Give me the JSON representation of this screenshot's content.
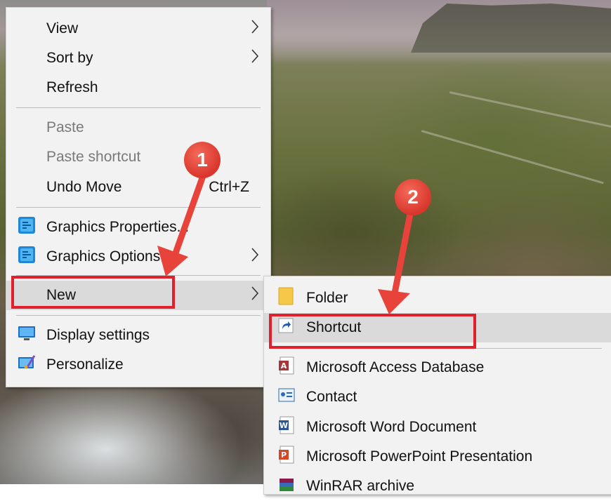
{
  "main_menu": {
    "items": [
      {
        "label": "View",
        "submenu": true
      },
      {
        "label": "Sort by",
        "submenu": true
      },
      {
        "label": "Refresh"
      },
      {
        "label": "Paste",
        "disabled": true
      },
      {
        "label": "Paste shortcut",
        "disabled": true
      },
      {
        "label": "Undo Move",
        "shortcut": "Ctrl+Z"
      },
      {
        "label": "Graphics Properties...",
        "icon": "intel-graphics-icon"
      },
      {
        "label": "Graphics Options",
        "icon": "intel-graphics-icon",
        "submenu": true
      },
      {
        "label": "New",
        "submenu": true,
        "highlighted": true
      },
      {
        "label": "Display settings",
        "icon": "display-icon"
      },
      {
        "label": "Personalize",
        "icon": "personalize-icon"
      }
    ]
  },
  "sub_menu": {
    "items": [
      {
        "label": "Folder",
        "icon": "folder-icon"
      },
      {
        "label": "Shortcut",
        "icon": "shortcut-icon",
        "highlighted": true
      },
      {
        "label": "Microsoft Access Database",
        "icon": "access-icon"
      },
      {
        "label": "Contact",
        "icon": "contact-icon"
      },
      {
        "label": "Microsoft Word Document",
        "icon": "word-icon"
      },
      {
        "label": "Microsoft PowerPoint Presentation",
        "icon": "powerpoint-icon"
      },
      {
        "label": "WinRAR archive",
        "icon": "winrar-icon"
      }
    ]
  },
  "annotations": {
    "step1": "1",
    "step2": "2"
  },
  "colors": {
    "annotation_red": "#e0202a",
    "menu_bg": "#f2f2f2",
    "hover_bg": "#dadada"
  }
}
